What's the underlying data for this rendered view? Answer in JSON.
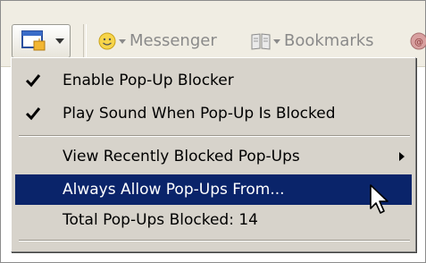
{
  "toolbar": {
    "popup_button_icon": "popup-blocker-icon",
    "messenger_label": "Messenger",
    "messenger_icon": "smiley-icon",
    "bookmarks_label": "Bookmarks",
    "bookmarks_icon": "book-icon"
  },
  "menu": {
    "items": [
      {
        "label": "Enable Pop-Up Blocker",
        "checked": true
      },
      {
        "label": "Play Sound When Pop-Up Is Blocked",
        "checked": true
      },
      {
        "label": "View Recently Blocked Pop-Ups",
        "submenu": true
      },
      {
        "label": "Always Allow Pop-Ups From...",
        "highlighted": true
      },
      {
        "label": "Total Pop-Ups Blocked: 14"
      }
    ]
  },
  "colors": {
    "highlight": "#0a246a",
    "menu_bg": "#d7d3cb",
    "toolbar_bg": "#f0ede3"
  }
}
